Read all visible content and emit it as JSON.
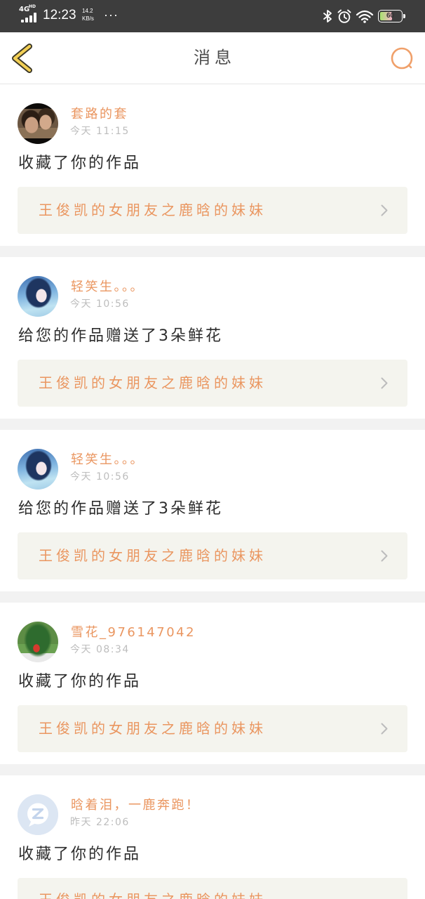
{
  "status_bar": {
    "network": "4G",
    "network_badge": "HD",
    "time": "12:23",
    "speed_value": "14.2",
    "speed_unit": "KB/s",
    "overflow": "···",
    "battery": "60",
    "icons": [
      "signal-icon",
      "bluetooth-icon",
      "alarm-icon",
      "wifi-icon",
      "battery-icon"
    ]
  },
  "header": {
    "title": "消息",
    "back_icon": "back-arrow-icon",
    "search_icon": "search-icon"
  },
  "messages": [
    {
      "username": "套路的套",
      "time": "今天 11:15",
      "text": "收藏了你的作品",
      "work_title": "王俊凯的女朋友之鹿晗的妹妹"
    },
    {
      "username": "轻笑生。。。",
      "time": "今天 10:56",
      "text": "给您的作品赠送了3朵鲜花",
      "work_title": "王俊凯的女朋友之鹿晗的妹妹"
    },
    {
      "username": "轻笑生。。。",
      "time": "今天 10:56",
      "text": "给您的作品赠送了3朵鲜花",
      "work_title": "王俊凯的女朋友之鹿晗的妹妹"
    },
    {
      "username": "雪花_976147042",
      "time": "今天 08:34",
      "text": "收藏了你的作品",
      "work_title": "王俊凯的女朋友之鹿晗的妹妹"
    },
    {
      "username": "晗着泪，一鹿奔跑！",
      "time": "昨天 22:06",
      "text": "收藏了你的作品",
      "work_title": "王俊凯的女朋友之鹿晗的妹妹"
    }
  ],
  "colors": {
    "accent": "#ea9660",
    "text": "#2d2d2d",
    "muted": "#bdbdbd",
    "box": "#f4f4ee",
    "separator": "#f2f2f2",
    "status_bar": "#3d3d3d",
    "title": "#4d4d4d"
  }
}
